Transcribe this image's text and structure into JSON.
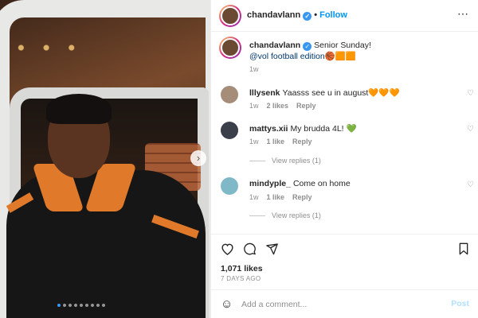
{
  "post": {
    "username": "chandavlann",
    "follow_label": "Follow",
    "verified_icon": "verified-badge-icon",
    "more_icon": "more-options-icon"
  },
  "caption": {
    "username": "chandavlann",
    "text": "Senior Sunday!",
    "mention": "@vol",
    "text2": "football edition",
    "emoji": "🏀🟧🟧",
    "time": "1w"
  },
  "comments": [
    {
      "username": "lllysenk",
      "text": "Yaasss see u in august",
      "emoji": "🧡🧡🧡",
      "time": "1w",
      "likes": "2 likes",
      "reply_label": "Reply",
      "avatar_color": "#a58d7a"
    },
    {
      "username": "mattys.xii",
      "text": "My brudda 4L!",
      "emoji": "💚",
      "time": "1w",
      "likes": "1 like",
      "reply_label": "Reply",
      "view_replies": "View replies (1)",
      "avatar_color": "#3b3f4a"
    },
    {
      "username": "mindyple_",
      "text": "Come on home",
      "emoji": "",
      "time": "1w",
      "likes": "1 like",
      "reply_label": "Reply",
      "view_replies": "View replies (1)",
      "avatar_color": "#7fb8c7"
    }
  ],
  "actions": {
    "like_icon": "heart-icon",
    "comment_icon": "comment-icon",
    "share_icon": "share-icon",
    "save_icon": "bookmark-icon"
  },
  "likes_text": "1,071 likes",
  "date_text": "7 DAYS AGO",
  "add_comment": {
    "placeholder": "Add a comment...",
    "post_label": "Post"
  },
  "carousel": {
    "slides": 9,
    "active_index": 0
  },
  "colors": {
    "accent": "#0095f6",
    "jacket_orange": "#e07a2a"
  }
}
